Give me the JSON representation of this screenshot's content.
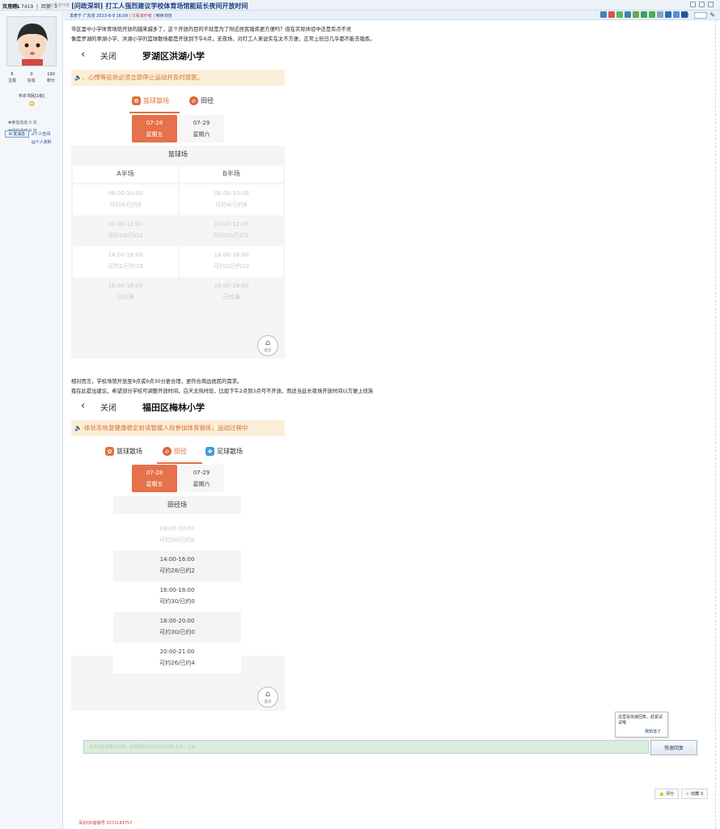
{
  "topbar": {
    "views_label": "查看",
    "views_value": "7419",
    "replies_label": "回复",
    "replies_value": "5",
    "thread_title": "[问政深圳] 打工人强烈建议学校体育场馆能延长夜间开放时间"
  },
  "user": {
    "username": "双月轩L",
    "poster_only": "只看该作者",
    "stats": [
      {
        "value": "6",
        "label": "主题"
      },
      {
        "value": "0",
        "label": "好友"
      },
      {
        "value": "190",
        "label": "积分"
      }
    ],
    "level": "布衣书民[1级]",
    "joined": "参加活动 0 次",
    "organized": "组织活动 0 次",
    "send_message": "发消息",
    "space_link": "个人空间",
    "profile_link": "个人资料"
  },
  "post": {
    "meta": "发表于 广东省 2023-8-9 16:09",
    "author_only": "只看该作者",
    "reverse_view": "倒序浏览",
    "font_label": "字号",
    "para1": "市区里中小学体育场馆开放的越来越多了，这个开放的目的不就是为了附近居民锻炼更方便吗？但在实际体验中还是有点不灵",
    "para2": "像是罗湖的翠湖小学、洪湖小学的篮球散场都是开放到下午6点，无夜场，对打工人来说实在太不方便，正常上班日几乎都不能去锻炼。",
    "para3": "相对而言，学校场馆开放至9点或9点30分更合理，更符合周边居民的需求。",
    "para4": "我在此提出建议，希望部分学校可调整开放时间，白天太热时段，比如下午2点到3点可不开放，而适当延长夜场开放时间以方便上班族"
  },
  "screenshot1": {
    "back": "‹",
    "close": "关闭",
    "school": "罗湖区洪湖小学",
    "banner": "🔈、心悸等症状必须立即停止运动并及时就医。",
    "tabs": [
      "篮球散场",
      "田径"
    ],
    "dates": [
      {
        "date": "07-28",
        "day": "星期五"
      },
      {
        "date": "07-29",
        "day": "星期六"
      }
    ],
    "venue": "篮球场",
    "halves": [
      "A半场",
      "B半场"
    ],
    "slots": [
      {
        "time": "08:00-10:00",
        "a": "可约4/已约8",
        "b": "可约4/已约8"
      },
      {
        "time": "10:00-12:00",
        "a": "可约10/已约2",
        "b": "可约10/已约2"
      },
      {
        "time": "14:00-16:00",
        "a": "可约2/已约10",
        "b": "可约2/已约10"
      },
      {
        "time": "16:00-18:00",
        "a": "已约满",
        "b": "已约满"
      }
    ],
    "home": "首页"
  },
  "screenshot2": {
    "back": "‹",
    "close": "关闭",
    "school": "福田区梅林小学",
    "banner": "🔈-体状态恢复健康稳定前请暂缓入校参加体育锻炼；运动过程中",
    "tabs": [
      "篮球散场",
      "田径",
      "足球散场"
    ],
    "dates": [
      {
        "date": "07-28",
        "day": "星期五"
      },
      {
        "date": "07-29",
        "day": "星期六"
      }
    ],
    "venue": "田径场",
    "slots": [
      {
        "time": "08:00-10:00",
        "status": "可约30/已约0"
      },
      {
        "time": "14:00-16:00",
        "status": "可约28/已约2"
      },
      {
        "time": "16:00-18:00",
        "status": "可约30/已约0"
      },
      {
        "time": "18:00-20:00",
        "status": "可约30/已约0"
      },
      {
        "time": "20:00-21:00",
        "status": "可约26/已约4"
      }
    ],
    "home": "首页"
  },
  "reply": {
    "tooltip": "这里是快速回复，赶紧试试哦",
    "tooltip_ack": "我知道了",
    "placeholder": "发表回复需要先登录，您需要登录后才可以回复 登录 | 注册",
    "button": "快速回复"
  },
  "actions": {
    "rate": "评分",
    "favorite": "收藏",
    "favorite_count": "0"
  },
  "footer": {
    "deleter": "深论QQ客服号 3372143757"
  }
}
